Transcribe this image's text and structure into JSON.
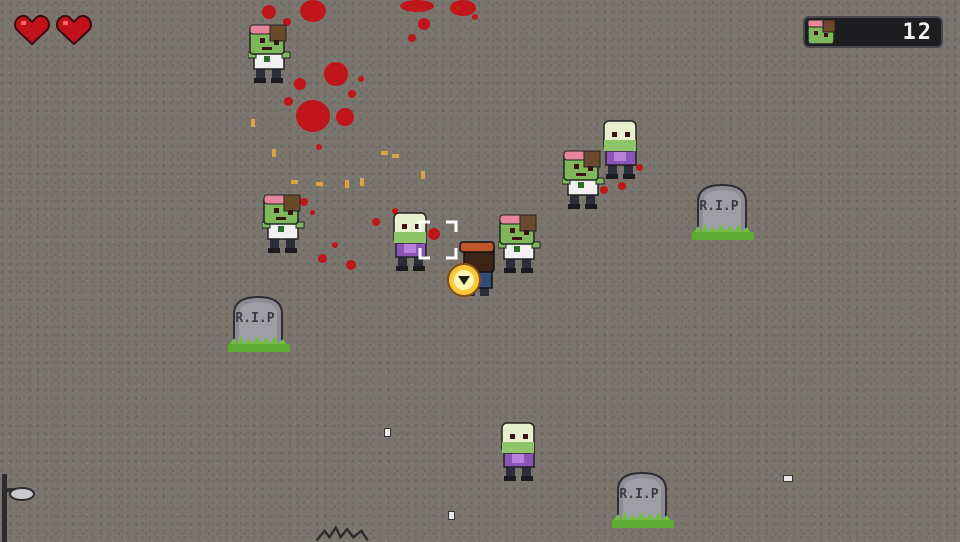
{
  "hud": {
    "hearts": [
      {
        "icon": "heart-icon",
        "state": "full"
      },
      {
        "icon": "heart-icon",
        "state": "full"
      }
    ],
    "kill_counter": {
      "icon": "zombie-head-icon",
      "value": "12"
    }
  },
  "tombstones": [
    {
      "label": "R.I.P"
    },
    {
      "label": "R.I.P"
    },
    {
      "label": "R.I.P"
    }
  ],
  "colors": {
    "ground": "#7a756d",
    "blood": "#c0151b",
    "zombie_skin": "#7fb85a",
    "heart": "#c1121c",
    "grass": "#5fa832"
  }
}
